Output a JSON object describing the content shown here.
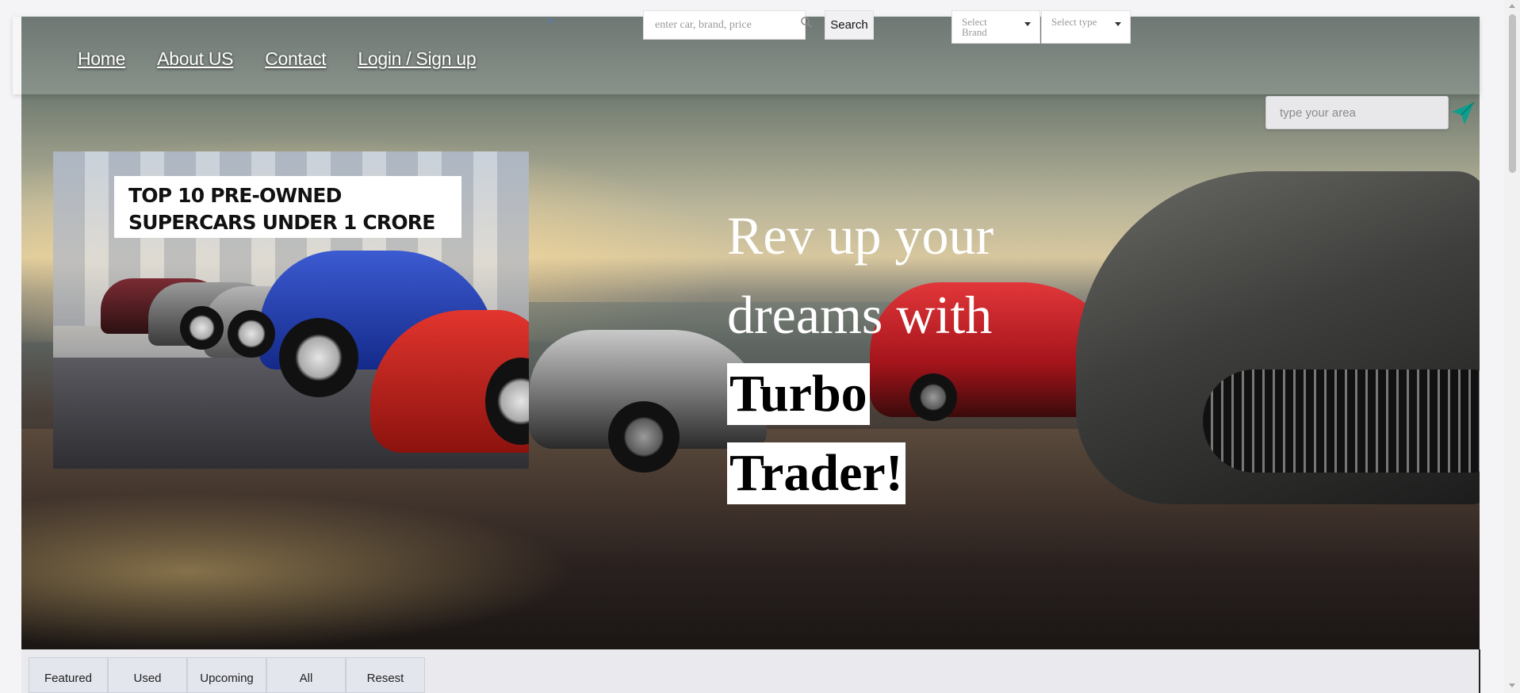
{
  "nav": {
    "links": [
      "Home",
      "About US",
      "Contact",
      "Login / Sign up"
    ]
  },
  "area_search": {
    "placeholder": "type your area",
    "locate_icon": "send-arrow-icon",
    "locate_color": "#0e9e8e"
  },
  "promo": {
    "title_line1": "TOP 10 PRE-OWNED",
    "title_line2": "SUPERCARS UNDER 1 CRORE"
  },
  "hero": {
    "line1": "Rev up your",
    "line2": "dreams with",
    "line3": "Turbo",
    "line4": "Trader!"
  },
  "filters": {
    "tabs": [
      "Featured",
      "Used",
      "Upcoming",
      "All",
      "Resest"
    ],
    "search_placeholder": "enter car, brand, price",
    "search_button": "Search",
    "brand_select": "Select Brand",
    "type_select": "Select type"
  }
}
